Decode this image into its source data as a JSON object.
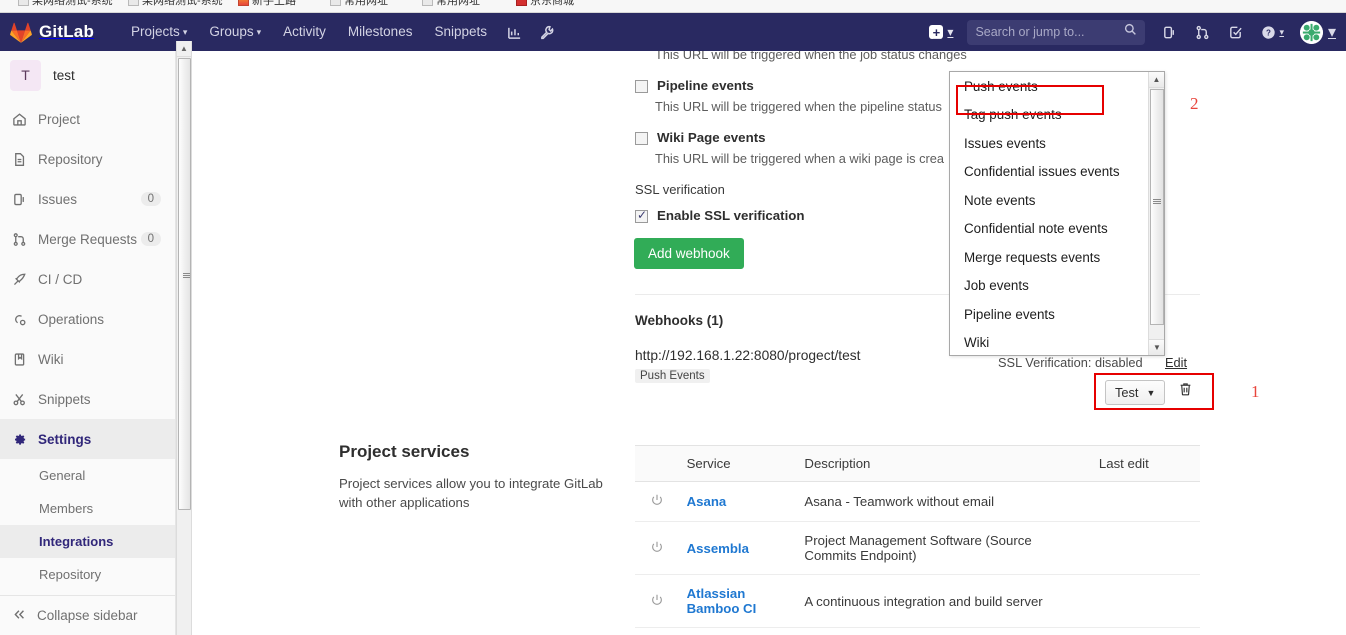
{
  "browser": {
    "bookmarks": [
      {
        "label": "某网络测试-系统",
        "icon": "page-icon"
      },
      {
        "label": "某网络测试-系统",
        "icon": "page-icon"
      },
      {
        "label": "新手上路",
        "icon": "firefox-icon"
      },
      {
        "label": "常用网址",
        "icon": "page-icon"
      },
      {
        "label": "常用网址",
        "icon": "page-icon"
      },
      {
        "label": "京东商城",
        "icon": "jd-icon"
      }
    ]
  },
  "navbar": {
    "brand": "GitLab",
    "links": [
      {
        "label": "Projects",
        "caret": true
      },
      {
        "label": "Groups",
        "caret": true
      },
      {
        "label": "Activity",
        "caret": false
      },
      {
        "label": "Milestones",
        "caret": false
      },
      {
        "label": "Snippets",
        "caret": false
      }
    ],
    "icon_links": [
      "chart-icon",
      "wrench-icon"
    ],
    "plus_label": "+",
    "search": {
      "placeholder": "Search or jump to...",
      "value": "",
      "icon": "search-icon"
    },
    "right_icons": [
      "issues-icon",
      "merge-requests-icon",
      "todos-icon",
      "help-icon"
    ],
    "avatar": "user-avatar"
  },
  "sidebar": {
    "project": {
      "initial": "T",
      "name": "test"
    },
    "items": [
      {
        "label": "Project",
        "icon": "home-icon",
        "badge": null
      },
      {
        "label": "Repository",
        "icon": "doc-icon",
        "badge": null
      },
      {
        "label": "Issues",
        "icon": "issues-icon",
        "badge": "0"
      },
      {
        "label": "Merge Requests",
        "icon": "merge-requests-icon",
        "badge": "0"
      },
      {
        "label": "CI / CD",
        "icon": "rocket-icon",
        "badge": null
      },
      {
        "label": "Operations",
        "icon": "operations-icon",
        "badge": null
      },
      {
        "label": "Wiki",
        "icon": "book-icon",
        "badge": null
      },
      {
        "label": "Snippets",
        "icon": "scissors-icon",
        "badge": null
      },
      {
        "label": "Settings",
        "icon": "gear-icon",
        "badge": null,
        "active": true
      }
    ],
    "settings_sub": [
      {
        "label": "General",
        "current": false
      },
      {
        "label": "Members",
        "current": false
      },
      {
        "label": "Integrations",
        "current": true
      },
      {
        "label": "Repository",
        "current": false
      }
    ],
    "collapse": {
      "label": "Collapse sidebar",
      "icon": "double-chevron-left-icon"
    }
  },
  "webhook_form": {
    "job_hint": "This URL will be triggered when the job status changes",
    "events": [
      {
        "title": "Pipeline events",
        "hint": "This URL will be triggered when the pipeline status",
        "checked": false
      },
      {
        "title": "Wiki Page events",
        "hint": "This URL will be triggered when a wiki page is crea",
        "checked": false
      }
    ],
    "ssl_section_label": "SSL verification",
    "ssl_checkbox": {
      "title": "Enable SSL verification",
      "checked": true
    },
    "add_button": "Add webhook"
  },
  "dropdown": {
    "items": [
      "Push events",
      "Tag push events",
      "Issues events",
      "Confidential issues events",
      "Note events",
      "Confidential note events",
      "Merge requests events",
      "Job events",
      "Pipeline events",
      "Wiki"
    ],
    "highlighted": "Push events",
    "scroll_up_icon": "triangle-up-icon",
    "scroll_down_icon": "triangle-down-icon"
  },
  "webhooks_list": {
    "heading": "Webhooks (1)",
    "entries": [
      {
        "url": "http://192.168.1.22:8080/progect/test",
        "tag": "Push Events",
        "ssl": "SSL Verification: disabled",
        "edit": "Edit",
        "test_button": "Test",
        "delete_icon": "trash-icon"
      }
    ]
  },
  "project_services": {
    "title": "Project services",
    "description": "Project services allow you to integrate GitLab with other applications",
    "table": {
      "headers": [
        "",
        "Service",
        "Description",
        "Last edit"
      ],
      "rows": [
        {
          "power": "power-icon",
          "service": "Asana",
          "description": "Asana - Teamwork without email",
          "last_edit": ""
        },
        {
          "power": "power-icon",
          "service": "Assembla",
          "description": "Project Management Software (Source Commits Endpoint)",
          "last_edit": ""
        },
        {
          "power": "power-icon",
          "service": "Atlassian Bamboo CI",
          "description": "A continuous integration and build server",
          "last_edit": ""
        }
      ]
    }
  },
  "annotations": {
    "marker_one": "1",
    "marker_two": "2"
  },
  "colors": {
    "navbar": "#292961",
    "accent_green": "#31ac57",
    "link_blue": "#1f78d1",
    "annotation_red": "#e60000",
    "sidebar_bg": "#fafafa"
  }
}
